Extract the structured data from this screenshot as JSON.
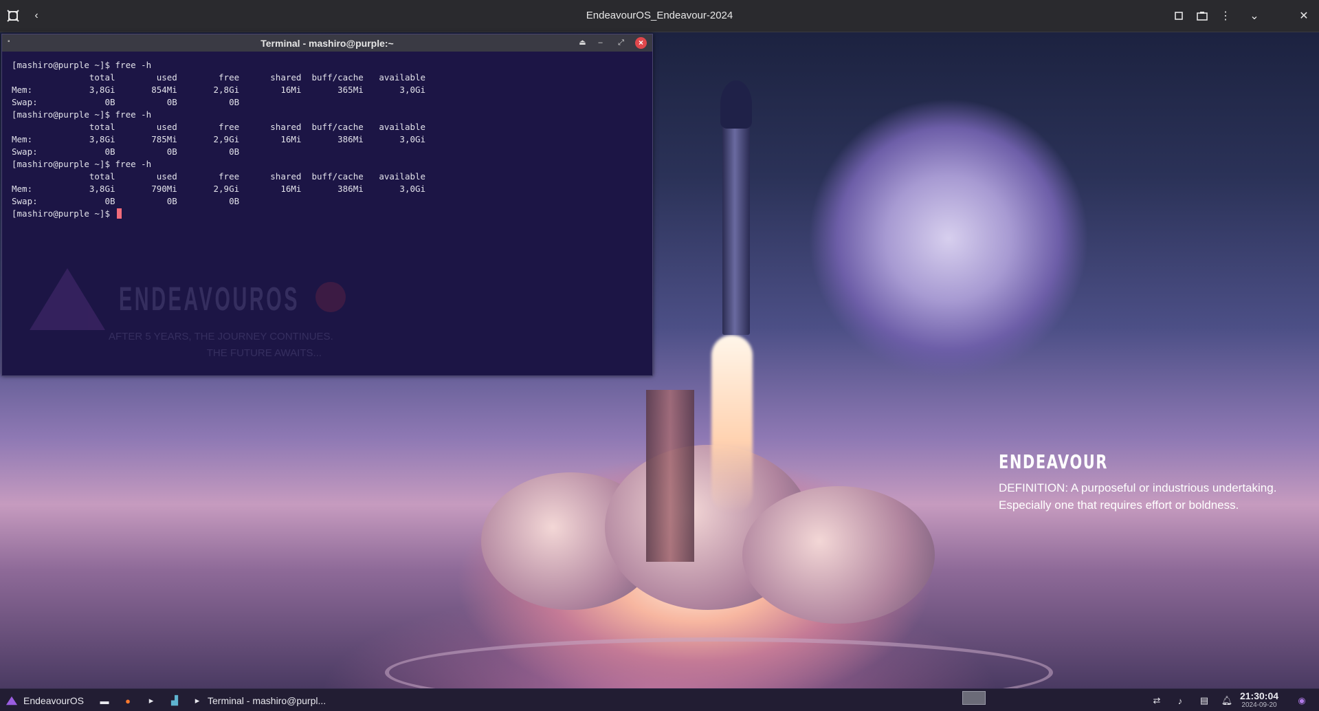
{
  "viewer": {
    "title": "EndeavourOS_Endeavour-2024",
    "left_icons": [
      "vm-logo-icon",
      "back-arrow-icon"
    ],
    "right_icons": [
      "fullscreen-icon",
      "screenshot-icon",
      "menu-dots-icon",
      "chevron-down-icon",
      "close-icon"
    ]
  },
  "terminal": {
    "title": "Terminal - mashiro@purple:~",
    "lines": [
      "[mashiro@purple ~]$ free -h",
      "               total        used        free      shared  buff/cache   available",
      "Mem:           3,8Gi       854Mi       2,8Gi        16Mi       365Mi       3,0Gi",
      "Swap:             0B          0B          0B",
      "[mashiro@purple ~]$ free -h",
      "               total        used        free      shared  buff/cache   available",
      "Mem:           3,8Gi       785Mi       2,9Gi        16Mi       386Mi       3,0Gi",
      "Swap:             0B          0B          0B",
      "[mashiro@purple ~]$ free -h",
      "               total        used        free      shared  buff/cache   available",
      "Mem:           3,8Gi       790Mi       2,9Gi        16Mi       386Mi       3,0Gi",
      "Swap:             0B          0B          0B"
    ],
    "prompt": "[mashiro@purple ~]$ ",
    "watermark": {
      "name": "ENDEAVOUROS",
      "tagline": "AFTER 5 YEARS, THE JOURNEY CONTINUES.\nTHE FUTURE AWAITS..."
    }
  },
  "wallpaper": {
    "title": "ENDEAVOUR",
    "definition": "DEFINITION: A purposeful or industrious undertaking. Especially one that requires effort or boldness."
  },
  "taskbar": {
    "menu_label": "EndeavourOS",
    "task_label": "Terminal - mashiro@purpl...",
    "time": "21:30:04",
    "date": "2024-09-20"
  }
}
